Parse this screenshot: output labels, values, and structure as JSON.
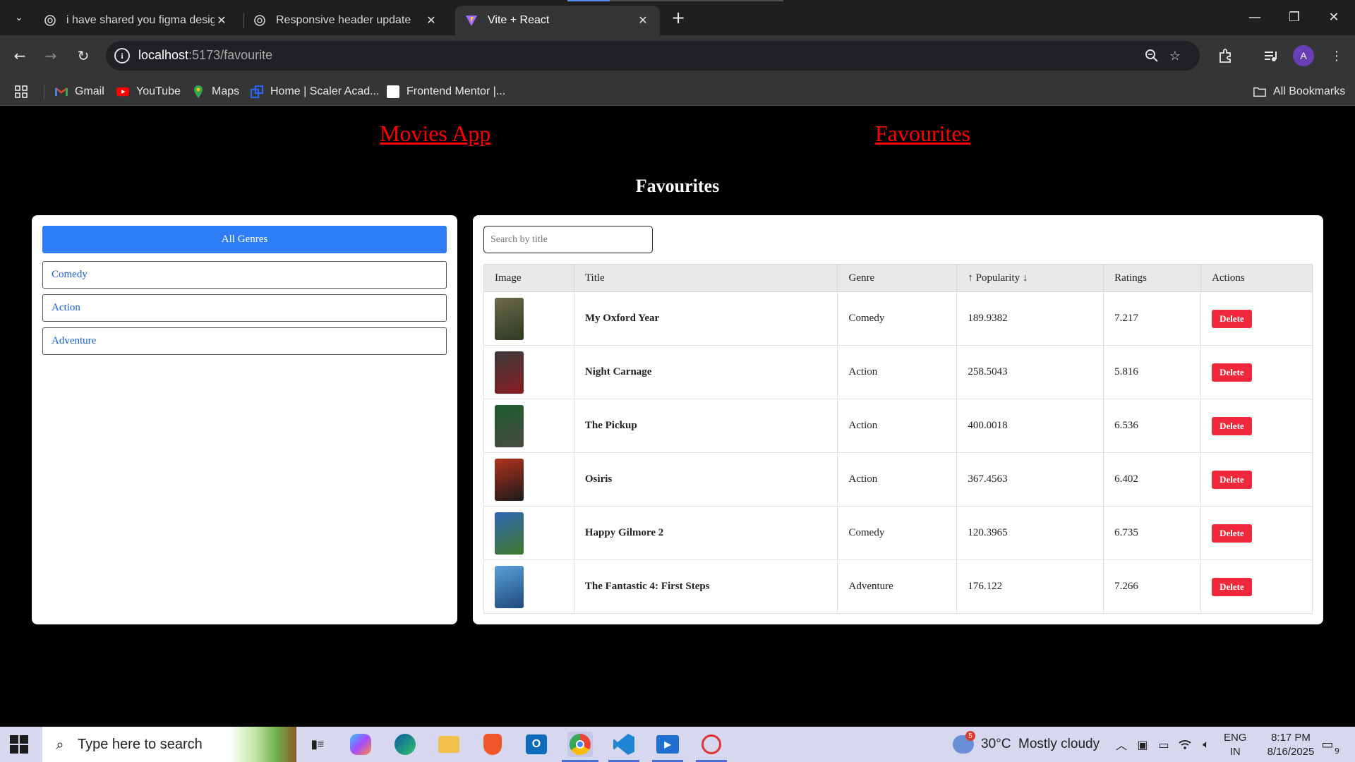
{
  "browser": {
    "tabs": [
      {
        "title": "i have shared you figma design",
        "active": false
      },
      {
        "title": "Responsive header update",
        "active": false
      },
      {
        "title": "Vite + React",
        "active": true
      }
    ],
    "url_host": "localhost",
    "url_rest": ":5173/favourite",
    "bookmarks": [
      {
        "label": "Gmail",
        "icon": "gmail-icon",
        "color": "#ea4335"
      },
      {
        "label": "YouTube",
        "icon": "youtube-icon",
        "color": "#ff0000"
      },
      {
        "label": "Maps",
        "icon": "maps-icon",
        "color": "#34a853"
      },
      {
        "label": "Home | Scaler Acad...",
        "icon": "scaler-icon",
        "color": "#2b65f5"
      },
      {
        "label": "Frontend Mentor |...",
        "icon": "frontend-mentor-icon",
        "color": "#ffffff"
      }
    ],
    "all_bookmarks": "All Bookmarks",
    "profile_initial": "A"
  },
  "app": {
    "nav": {
      "home_link": "Movies App",
      "favourites_link": "Favourites"
    },
    "page_title": "Favourites",
    "genres": {
      "all_label": "All Genres",
      "items": [
        "Comedy",
        "Action",
        "Adventure"
      ]
    },
    "search": {
      "placeholder": "Search by title",
      "value": ""
    },
    "table": {
      "headers": {
        "image": "Image",
        "title": "Title",
        "genre": "Genre",
        "popularity": "Popularity",
        "sort_up": "↑",
        "sort_down": "↓",
        "ratings": "Ratings",
        "actions": "Actions"
      },
      "delete_label": "Delete",
      "rows": [
        {
          "title": "My Oxford Year",
          "genre": "Comedy",
          "popularity": "189.9382",
          "rating": "7.217",
          "poster_colors": [
            "#6b6a4a",
            "#2e3a22"
          ]
        },
        {
          "title": "Night Carnage",
          "genre": "Action",
          "popularity": "258.5043",
          "rating": "5.816",
          "poster_colors": [
            "#3a3a3a",
            "#8a1c22"
          ]
        },
        {
          "title": "The Pickup",
          "genre": "Action",
          "popularity": "400.0018",
          "rating": "6.536",
          "poster_colors": [
            "#1c5e2a",
            "#4a4a44"
          ]
        },
        {
          "title": "Osiris",
          "genre": "Action",
          "popularity": "367.4563",
          "rating": "6.402",
          "poster_colors": [
            "#b2331c",
            "#1a1a1a"
          ]
        },
        {
          "title": "Happy Gilmore 2",
          "genre": "Comedy",
          "popularity": "120.3965",
          "rating": "6.735",
          "poster_colors": [
            "#2f66b5",
            "#3f7a2a"
          ]
        },
        {
          "title": "The Fantastic 4: First Steps",
          "genre": "Adventure",
          "popularity": "176.122",
          "rating": "7.266",
          "poster_colors": [
            "#5aa0d8",
            "#1f4a7a"
          ]
        }
      ]
    }
  },
  "taskbar": {
    "search_placeholder": "Type here to search",
    "weather": "30°C  Mostly cloudy",
    "weather_badge": "5",
    "lang_line1": "ENG",
    "lang_line2": "IN",
    "time": "8:17 PM",
    "date": "8/16/2025",
    "notification_count": "9"
  }
}
